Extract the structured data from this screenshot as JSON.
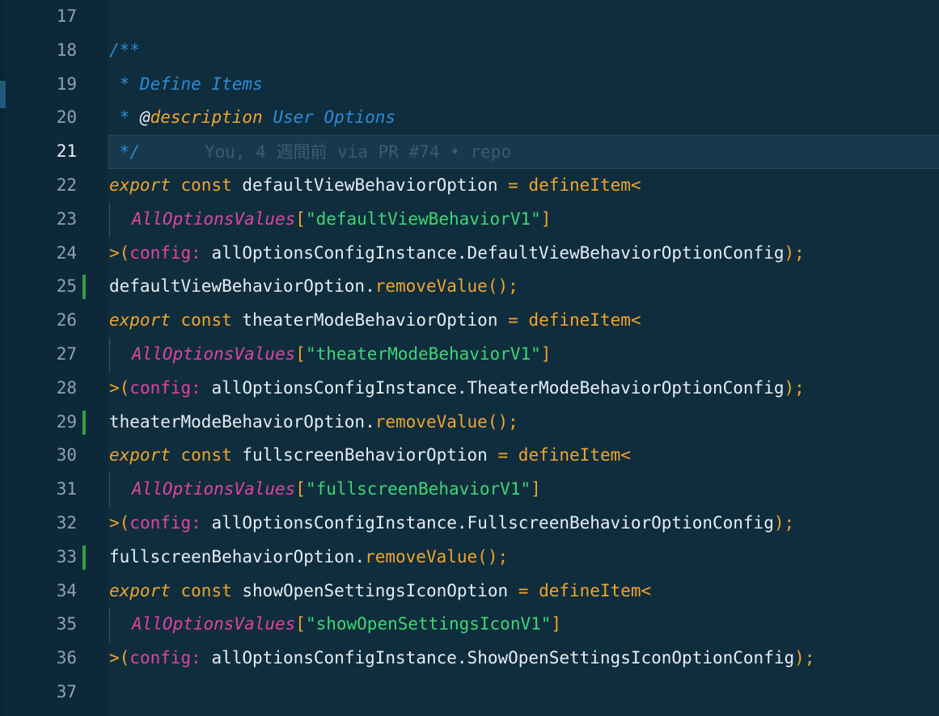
{
  "editor": {
    "language": "typescript",
    "theme_colors": {
      "background": "#0f2d3d",
      "comment": "#2f8bd6",
      "keyword": "#f0a52d",
      "type": "#e0449e",
      "string": "#3ed675",
      "git_added": "#2ea043"
    },
    "current_line": 21,
    "lines": [
      {
        "no": "17"
      },
      {
        "no": "18",
        "comment": "/**"
      },
      {
        "no": "19",
        "comment": " * Define Items"
      },
      {
        "no": "20",
        "comment_star": " * ",
        "doc_at": "@",
        "doc_tag": "description",
        "comment_rest": " User Options"
      },
      {
        "no": "21",
        "comment": " */",
        "blame": "You, 4 週間前 via PR #74 • repo"
      },
      {
        "no": "22",
        "kw": "export",
        "kw2": "const",
        "name": "defaultViewBehaviorOption",
        "eq": "=",
        "fn": "defineItem",
        "open": "<"
      },
      {
        "no": "23",
        "type": "AllOptionsValues",
        "bopen": "[",
        "str": "\"defaultViewBehaviorV1\"",
        "bclose": "]"
      },
      {
        "no": "24",
        "close": ">(",
        "param": "config:",
        "expr": "allOptionsConfigInstance.DefaultViewBehaviorOptionConfig",
        "end": ");"
      },
      {
        "no": "25",
        "obj": "defaultViewBehaviorOption",
        "dot": ".",
        "method": "removeValue",
        "call": "();",
        "git": true
      },
      {
        "no": "26",
        "kw": "export",
        "kw2": "const",
        "name": "theaterModeBehaviorOption",
        "eq": "=",
        "fn": "defineItem",
        "open": "<"
      },
      {
        "no": "27",
        "type": "AllOptionsValues",
        "bopen": "[",
        "str": "\"theaterModeBehaviorV1\"",
        "bclose": "]"
      },
      {
        "no": "28",
        "close": ">(",
        "param": "config:",
        "expr": "allOptionsConfigInstance.TheaterModeBehaviorOptionConfig",
        "end": ");"
      },
      {
        "no": "29",
        "obj": "theaterModeBehaviorOption",
        "dot": ".",
        "method": "removeValue",
        "call": "();",
        "git": true
      },
      {
        "no": "30",
        "kw": "export",
        "kw2": "const",
        "name": "fullscreenBehaviorOption",
        "eq": "=",
        "fn": "defineItem",
        "open": "<"
      },
      {
        "no": "31",
        "type": "AllOptionsValues",
        "bopen": "[",
        "str": "\"fullscreenBehaviorV1\"",
        "bclose": "]"
      },
      {
        "no": "32",
        "close": ">(",
        "param": "config:",
        "expr": "allOptionsConfigInstance.FullscreenBehaviorOptionConfig",
        "end": ");"
      },
      {
        "no": "33",
        "obj": "fullscreenBehaviorOption",
        "dot": ".",
        "method": "removeValue",
        "call": "();",
        "git": true
      },
      {
        "no": "34",
        "kw": "export",
        "kw2": "const",
        "name": "showOpenSettingsIconOption",
        "eq": "=",
        "fn": "defineItem",
        "open": "<"
      },
      {
        "no": "35",
        "type": "AllOptionsValues",
        "bopen": "[",
        "str": "\"showOpenSettingsIconV1\"",
        "bclose": "]"
      },
      {
        "no": "36",
        "close": ">(",
        "param": "config:",
        "expr": "allOptionsConfigInstance.ShowOpenSettingsIconOptionConfig",
        "end": ");"
      },
      {
        "no": "37"
      }
    ]
  }
}
